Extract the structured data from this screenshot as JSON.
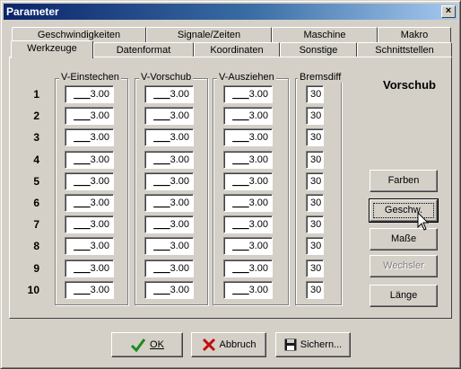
{
  "window": {
    "title": "Parameter",
    "close_glyph": "×"
  },
  "tabs_row1": [
    "Geschwindigkeiten",
    "Signale/Zeiten",
    "Maschine",
    "Makro"
  ],
  "tabs_row2": [
    "Werkzeuge",
    "Datenformat",
    "Koordinaten",
    "Sonstige",
    "Schnittstellen"
  ],
  "active_tab": "Werkzeuge",
  "groups": {
    "einstechen": "V-Einstechen",
    "vorschub": "V-Vorschub",
    "ausziehen": "V-Ausziehen",
    "bremsdiff": "Bremsdiff"
  },
  "rows": [
    {
      "num": "1",
      "prefix": "___",
      "einstechen": "3.00",
      "vorschub": "3.00",
      "ausziehen": "3.00",
      "bremsdiff": "30"
    },
    {
      "num": "2",
      "prefix": "___",
      "einstechen": "3.00",
      "vorschub": "3.00",
      "ausziehen": "3.00",
      "bremsdiff": "30"
    },
    {
      "num": "3",
      "prefix": "___",
      "einstechen": "3.00",
      "vorschub": "3.00",
      "ausziehen": "3.00",
      "bremsdiff": "30"
    },
    {
      "num": "4",
      "prefix": "___",
      "einstechen": "3.00",
      "vorschub": "3.00",
      "ausziehen": "3.00",
      "bremsdiff": "30"
    },
    {
      "num": "5",
      "prefix": "___",
      "einstechen": "3.00",
      "vorschub": "3.00",
      "ausziehen": "3.00",
      "bremsdiff": "30"
    },
    {
      "num": "6",
      "prefix": "___",
      "einstechen": "3.00",
      "vorschub": "3.00",
      "ausziehen": "3.00",
      "bremsdiff": "30"
    },
    {
      "num": "7",
      "prefix": "___",
      "einstechen": "3.00",
      "vorschub": "3.00",
      "ausziehen": "3.00",
      "bremsdiff": "30"
    },
    {
      "num": "8",
      "prefix": "___",
      "einstechen": "3.00",
      "vorschub": "3.00",
      "ausziehen": "3.00",
      "bremsdiff": "30"
    },
    {
      "num": "9",
      "prefix": "___",
      "einstechen": "3.00",
      "vorschub": "3.00",
      "ausziehen": "3.00",
      "bremsdiff": "30"
    },
    {
      "num": "10",
      "prefix": "___",
      "einstechen": "3.00",
      "vorschub": "3.00",
      "ausziehen": "3.00",
      "bremsdiff": "30"
    }
  ],
  "side": {
    "heading": "Vorschub",
    "buttons": [
      {
        "label": "Farben",
        "name": "farben-button",
        "enabled": true,
        "focused": false
      },
      {
        "label": "Geschw.",
        "name": "geschw-button",
        "enabled": true,
        "focused": true
      },
      {
        "label": "Maße",
        "name": "masse-button",
        "enabled": true,
        "focused": false
      },
      {
        "label": "Wechsler",
        "name": "wechsler-button",
        "enabled": false,
        "focused": false
      },
      {
        "label": "Länge",
        "name": "laenge-button",
        "enabled": true,
        "focused": false
      }
    ]
  },
  "footer": {
    "ok": "OK",
    "abbruch": "Abbruch",
    "sichern": "Sichern..."
  },
  "colors": {
    "dialog_bg": "#d4d0c8",
    "title_start": "#0a246a",
    "title_end": "#a6caf0",
    "ok_check": "#1f8a1f",
    "cancel_x": "#c01010"
  },
  "icons": {
    "ok": "check-icon",
    "abbruch": "x-icon",
    "sichern": "floppy-disk-icon",
    "cursor": "mouse-pointer-icon"
  }
}
